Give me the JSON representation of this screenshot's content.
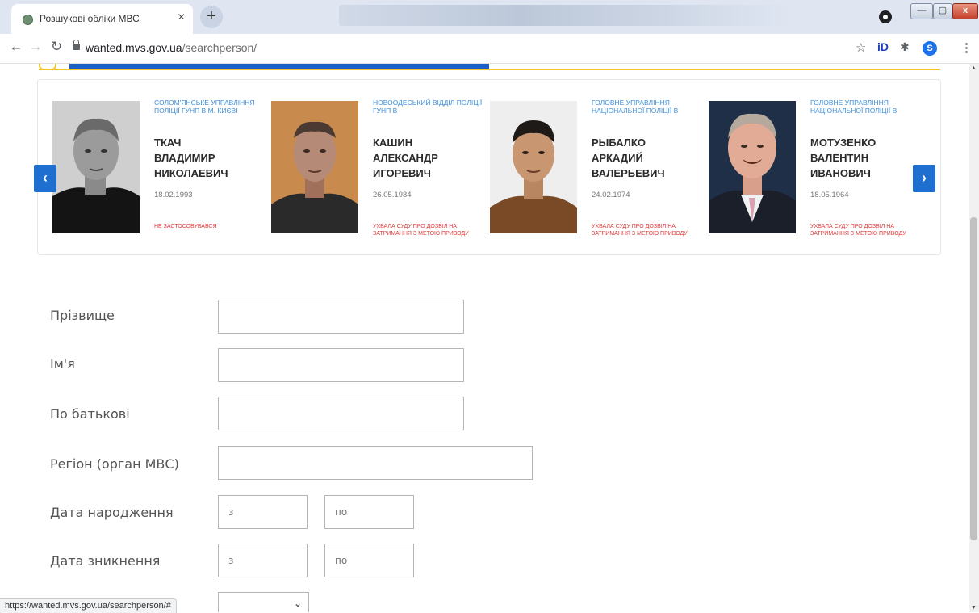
{
  "browser": {
    "tab_title": "Розшукові обліки МВС",
    "tab_close": "×",
    "new_tab": "+",
    "url_host": "wanted.mvs.gov.ua",
    "url_path": "/searchperson/",
    "avatar_letter": "S",
    "status_url": "https://wanted.mvs.gov.ua/searchperson/#",
    "window_buttons": {
      "minimize": "—",
      "maximize": "▢",
      "close": "x"
    }
  },
  "toolbar_icons": [
    "back-icon",
    "forward-icon",
    "reload-icon",
    "lock-icon",
    "star-icon",
    "extension-icon",
    "puzzle-icon",
    "menu-icon"
  ],
  "carousel": {
    "prev": "‹",
    "next": "›",
    "cards": [
      {
        "agency": "Солом'янське управління поліції ГУНП в м. Києві",
        "name": "ТКАЧ\nВЛАДИМИР\nНИКОЛАЕВИЧ",
        "dob": "18.02.1993",
        "status": "Не застосовувався"
      },
      {
        "agency": "Новоодеський відділ поліції ГУНП в",
        "name": "КАШИН\nАЛЕКСАНДР\nИГОРЕВИЧ",
        "dob": "26.05.1984",
        "status": "Ухвала суду про дозвіл на затримання з метою приводу"
      },
      {
        "agency": "Головне управління Національної поліції в",
        "name": "РЫБАЛКО\nАРКАДИЙ\nВАЛЕРЬЕВИЧ",
        "dob": "24.02.1974",
        "status": "Ухвала суду про дозвіл на затримання з метою приводу"
      },
      {
        "agency": "Головне управління Національної поліції в",
        "name": "МОТУЗЕНКО\nВАЛЕНТИН\nИВАНОВИЧ",
        "dob": "18.05.1964",
        "status": "Ухвала суду про дозвіл на затримання з метою приводу"
      }
    ]
  },
  "form": {
    "surname_label": "Прізвище",
    "name_label": "Ім'я",
    "patronymic_label": "По батькові",
    "region_label": "Регіон (орган МВС)",
    "birth_label": "Дата народження",
    "missing_label": "Дата зникнення",
    "from_placeholder": "з",
    "to_placeholder": "по"
  },
  "colors": {
    "accent_blue": "#1e6fd0",
    "agency_blue": "#3f8fd8",
    "status_red": "#e03b3b",
    "banner_yellow": "#f3c623"
  }
}
